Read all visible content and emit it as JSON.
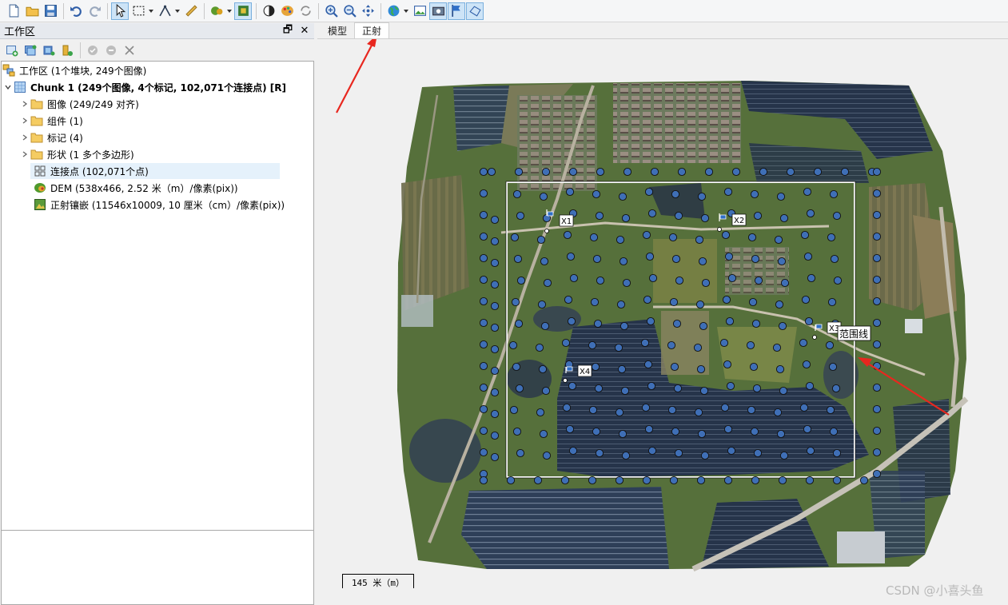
{
  "toolbar": {
    "icons": [
      "new-icon",
      "open-icon",
      "save-icon",
      "undo-icon",
      "redo-icon",
      "select-icon",
      "rect-select-icon",
      "ruler-tool-icon",
      "ruler-icon",
      "marker-icon",
      "sample-icon",
      "contrast-icon",
      "palette-icon",
      "rotate-icon",
      "zoom-in-icon",
      "zoom-out-icon",
      "move-icon",
      "globe-icon",
      "image-icon",
      "camera-icon",
      "flag-icon",
      "shape-icon"
    ]
  },
  "workspace": {
    "title": "工作区",
    "restore_glyph": "🗗",
    "close_glyph": "✕"
  },
  "tree": {
    "root": "工作区 (1个堆块, 249个图像)",
    "chunk": "Chunk 1 (249个图像, 4个标记, 102,071个连接点) [R]",
    "items": [
      {
        "label": "图像 (249/249 对齐)",
        "icon": "folder-icon"
      },
      {
        "label": "组件 (1)",
        "icon": "folder-icon"
      },
      {
        "label": "标记 (4)",
        "icon": "folder-icon"
      },
      {
        "label": "形状 (1 多个多边形)",
        "icon": "folder-icon"
      },
      {
        "label": "连接点 (102,071个点)",
        "icon": "tiepoints-icon"
      },
      {
        "label": "DEM (538x466, 2.52 米（m）/像素(pix))",
        "icon": "dem-icon"
      },
      {
        "label": "正射镶嵌 (11546x10009, 10 厘米（cm）/像素(pix))",
        "icon": "ortho-icon"
      }
    ],
    "expand_glyph": "›",
    "collapse_glyph": "⌄"
  },
  "view": {
    "tabs": [
      {
        "label": "模型",
        "active": false
      },
      {
        "label": "正射",
        "active": true
      }
    ],
    "markers": [
      {
        "label": "X1"
      },
      {
        "label": "X2"
      },
      {
        "label": "X3"
      },
      {
        "label": "X4"
      }
    ],
    "annotation": "范围线",
    "scale_label": "145 米（m）",
    "watermark": "CSDN @小喜头鱼"
  },
  "colors": {
    "selection": "#e5f1fb",
    "tiepoint_fill": "#3f6fb6",
    "arrow": "#e8271f",
    "aerial_green": "#55703a",
    "water": "#3a4a52",
    "solar_panel": "#2a3850"
  }
}
